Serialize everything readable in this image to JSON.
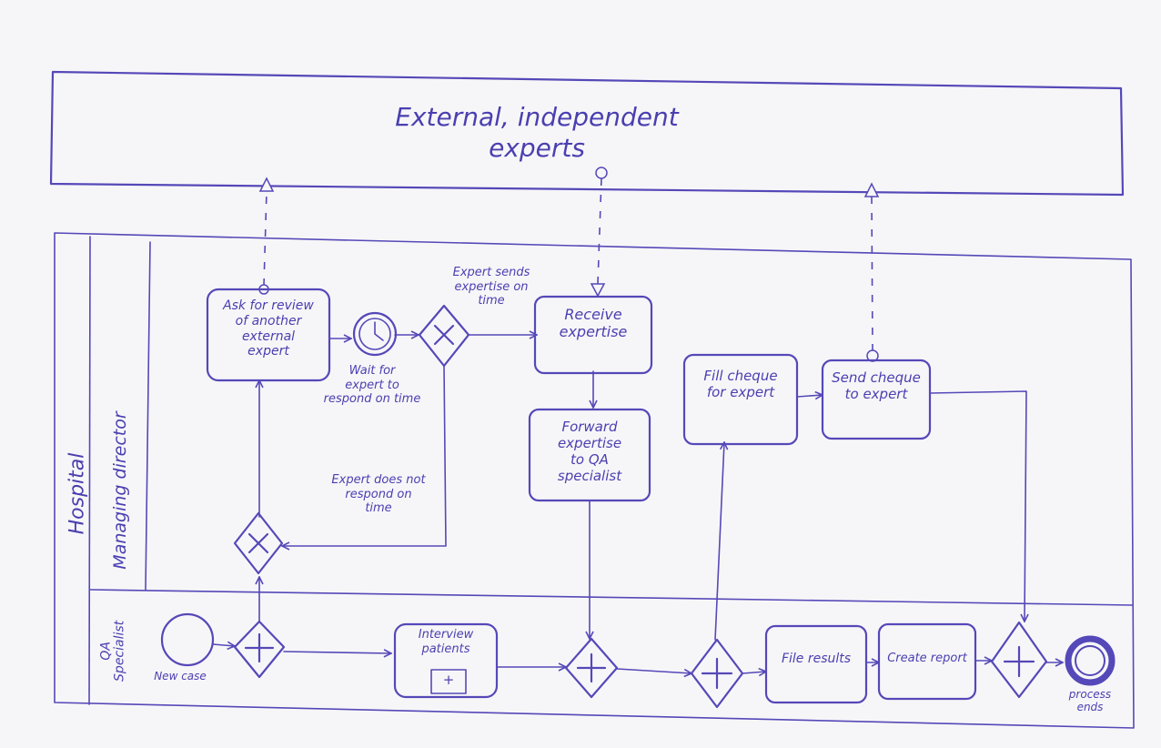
{
  "pools": {
    "external": {
      "label": "External, independent experts"
    },
    "hospital": {
      "label": "Hospital"
    }
  },
  "lanes": {
    "managing_director": "Managing director",
    "qa_specialist": "QA\nSpecialist"
  },
  "tasks": {
    "ask_review": "Ask for review\nof another\nexternal\nexpert",
    "receive_expertise": "Receive\nexpertise",
    "forward_expertise": "Forward\nexpertise\nto QA\nspecialist",
    "fill_cheque": "Fill cheque\nfor expert",
    "send_cheque": "Send cheque\nto expert",
    "interview_patients": "Interview\npatients",
    "interview_marker": "+",
    "file_results": "File results",
    "create_report": "Create report"
  },
  "events": {
    "start": "New case",
    "timer": "Wait for\nexpert to\nrespond on time",
    "end": "process\nends"
  },
  "flow_labels": {
    "on_time": "Expert sends\nexpertise on\ntime",
    "not_on_time": "Expert does not\nrespond on\ntime"
  },
  "colors": {
    "ink": "#5548b8",
    "paper": "#f6f6f8"
  }
}
